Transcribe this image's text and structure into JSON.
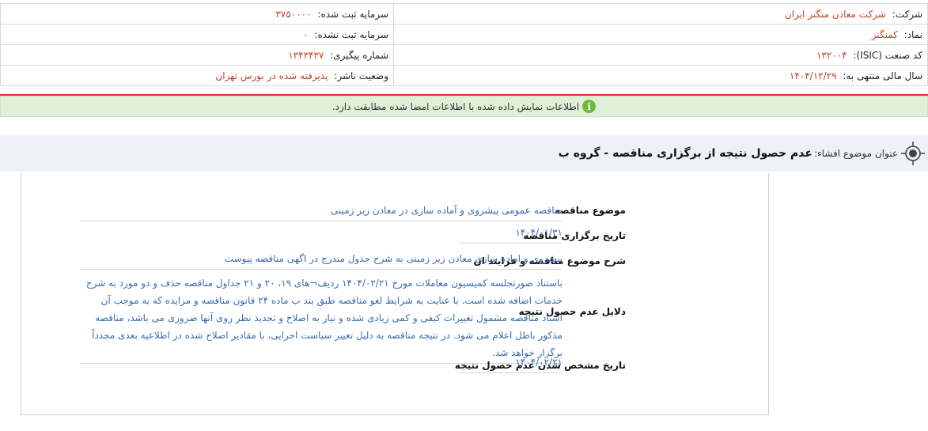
{
  "company_info": {
    "company_label": "شرکت:",
    "company_value": "شرکت معادن منگنز ایران",
    "registered_capital_label": "سرمایه ثبت شده:",
    "registered_capital_value": "۳۷۵۰۰۰۰",
    "symbol_label": "نماد:",
    "symbol_value": "کمنگنز",
    "unregistered_capital_label": "سرمایه ثبت نشده:",
    "unregistered_capital_value": "۰",
    "isic_label": "کد صنعت (ISIC):",
    "isic_value": "۱۳۲۰۰۴",
    "tracking_label": "شماره پیگیری:",
    "tracking_value": "۱۳۴۳۴۳۷",
    "fiscal_year_label": "سال مالی منتهی به:",
    "fiscal_year_value": "۱۴۰۴/۱۲/۲۹",
    "publisher_status_label": "وضعیت ناشر:",
    "publisher_status_value": "پذیرفته شده در بورس تهران"
  },
  "banner": {
    "icon": "info-icon",
    "text": "اطلاعات نمایش داده شده با اطلاعات امضا شده مطابقت دارد."
  },
  "subject": {
    "icon": "target-icon",
    "label": "عنوان موضوع افشاء:",
    "title": "عدم حصول نتیجه از برگزاری مناقصه - گروه ب"
  },
  "details": [
    {
      "label": "موضوع مناقصه",
      "value": "مناقصه عمومی پیشروی و آماده سازی در معادن زیر زمینی"
    },
    {
      "label": "تاریخ برگزاری مناقصه",
      "value": "۱۴۰۴/۰۱/۳۱"
    },
    {
      "label": "شرح موضوع مناقصه و فرایند ان",
      "value": "پیشروی و اماده سازی معادن زیر زمینی به شرح جدول مندرج در اگهی مناقصه پیوست"
    },
    {
      "label": "دلایل عدم حصول نتیجه",
      "value": "باستناد صورتجلسه کمیسیون معاملات مورخ ۱۴۰۴/۰۲/۲۱ ردیف¬های ۱۹، ۲۰ و ۲۱ جداول مناقصه حذف و دو مورد به شرح خدمات اضافه شده است. با عنایت به شرایط لغو مناقصه طبق بند ب ماده ۲۴ قانون مناقصه و مزایده که به موجب آن اسناد مناقصه مشمول تغییرات کیفی و کمی زیادی شده و نیاز به اصلاح و تجدید نظر روی آنها ضروری می باشد، مناقصه مذکور باطل اعلام می شود. در نتیجه مناقصه به دلیل تغییر سیاست اجرایی، با مقادیر اصلاح شده در اطلاعیه بعدی مجدداً برگزار خواهد شد."
    },
    {
      "label": "تاریخ مشخص شدن عدم حصول نتیجه",
      "value": "۱۴۰۴/۰۲/۲۱"
    }
  ]
}
